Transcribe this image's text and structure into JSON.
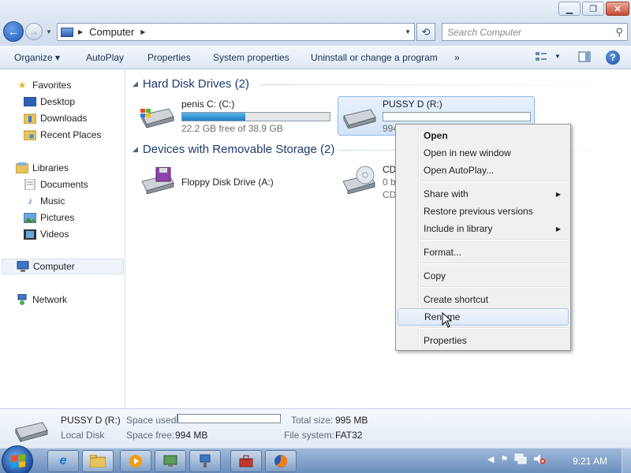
{
  "window": {
    "minimize_label": "▁",
    "maximize_label": "❐",
    "close_label": "✕"
  },
  "address": {
    "crumb": "Computer",
    "search_placeholder": "Search Computer"
  },
  "toolbar": {
    "organize": "Organize ▾",
    "autoplay": "AutoPlay",
    "properties": "Properties",
    "system_properties": "System properties",
    "uninstall": "Uninstall or change a program",
    "more": "»",
    "help": "?"
  },
  "nav": {
    "favorites": "Favorites",
    "desktop": "Desktop",
    "downloads": "Downloads",
    "recent_places": "Recent Places",
    "libraries": "Libraries",
    "documents": "Documents",
    "music": "Music",
    "pictures": "Pictures",
    "videos": "Videos",
    "computer": "Computer",
    "network": "Network"
  },
  "groups": {
    "hdd": "Hard Disk Drives (2)",
    "removable": "Devices with Removable Storage (2)"
  },
  "drives": {
    "c": {
      "name": "penis C: (C:)",
      "free": "22.2 GB free of 38.9 GB",
      "used_fraction": 0.43
    },
    "d": {
      "name": "PUSSY D (R:)",
      "free": "994",
      "used_fraction": 0.001
    },
    "floppy": {
      "name": "Floppy Disk Drive (A:)"
    },
    "cd": {
      "name": "CD",
      "line2": "0 b",
      "line3": "CD"
    }
  },
  "context_menu": {
    "open": "Open",
    "open_new_window": "Open in new window",
    "open_autoplay": "Open AutoPlay...",
    "share_with": "Share with",
    "restore": "Restore previous versions",
    "include_library": "Include in library",
    "format": "Format...",
    "copy": "Copy",
    "create_shortcut": "Create shortcut",
    "rename": "Rename",
    "properties": "Properties",
    "submenu_arrow": "▶"
  },
  "details": {
    "name": "PUSSY D (R:)",
    "type": "Local Disk",
    "space_used_label": "Space used:",
    "space_free_label": "Space free:",
    "space_free": "994 MB",
    "total_size_label": "Total size:",
    "total_size": "995 MB",
    "file_system_label": "File system:",
    "file_system": "FAT32",
    "used_fraction": 0.001
  },
  "taskbar": {
    "clock": "9:21 AM",
    "tray_arrow": "◀"
  },
  "colors": {
    "selection": "#d4e5f9",
    "capacity_fill": "#1f7fc5",
    "taskbar": "#6b8fbd"
  }
}
